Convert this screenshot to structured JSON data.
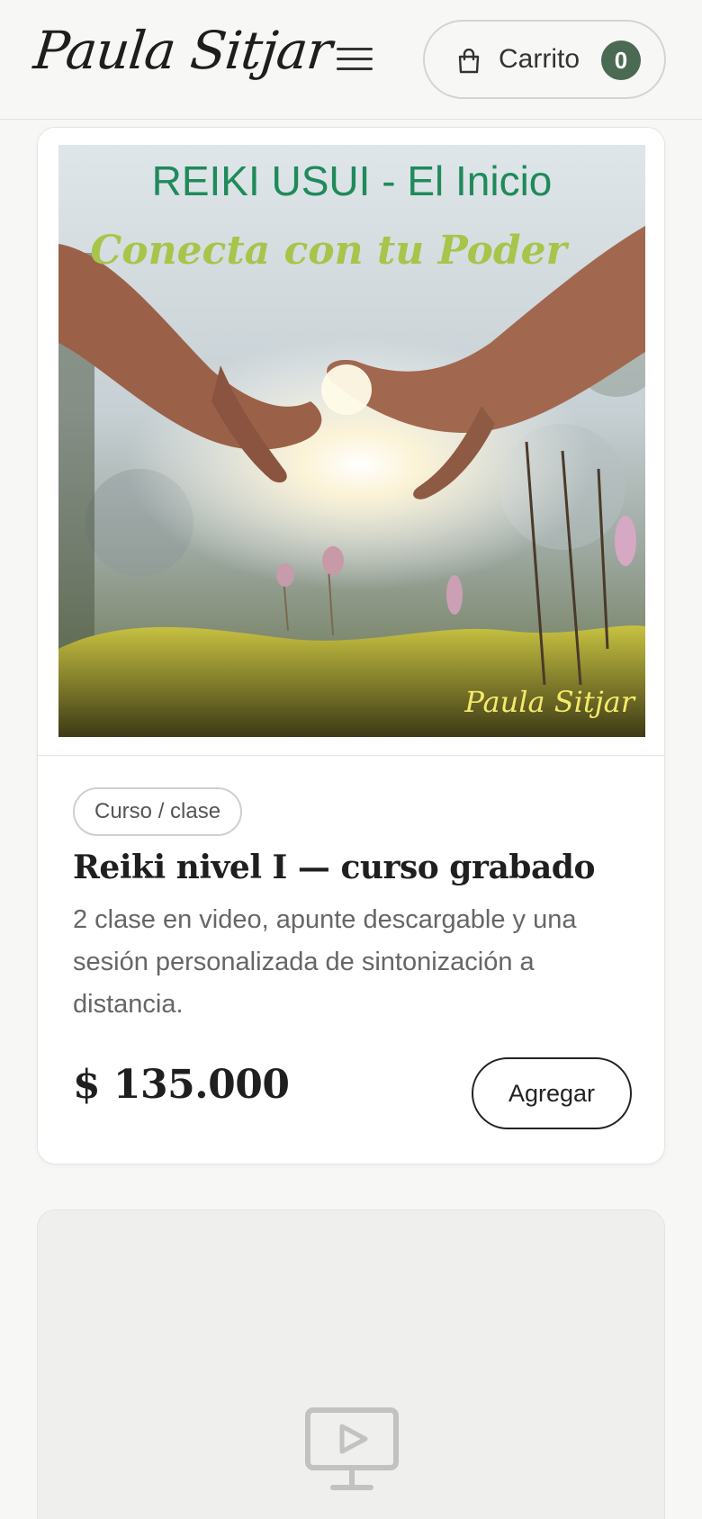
{
  "header": {
    "logo_text": "Paula Sitjar",
    "menu_icon": "hamburger-menu-icon",
    "cart": {
      "label": "Carrito",
      "count": "0",
      "icon": "shopping-bag-icon"
    }
  },
  "product": {
    "image_title_line1": "REIKI USUI - El Inicio",
    "image_title_line2": "Conecta con tu Poder",
    "image_signature": "Paula Sitjar",
    "category_tag": "Curso / clase",
    "title": "Reiki nivel I — curso grabado",
    "description": "2 clase en video, apunte descargable y una sesión personalizada de sintonización a distancia.",
    "price": "$ 135.000",
    "add_button_label": "Agregar"
  },
  "next_product": {
    "placeholder_icon": "video-monitor-icon"
  },
  "colors": {
    "background": "#f7f7f5",
    "accent_badge": "#4a6a53",
    "card": "#ffffff",
    "placeholder": "#efefed"
  }
}
